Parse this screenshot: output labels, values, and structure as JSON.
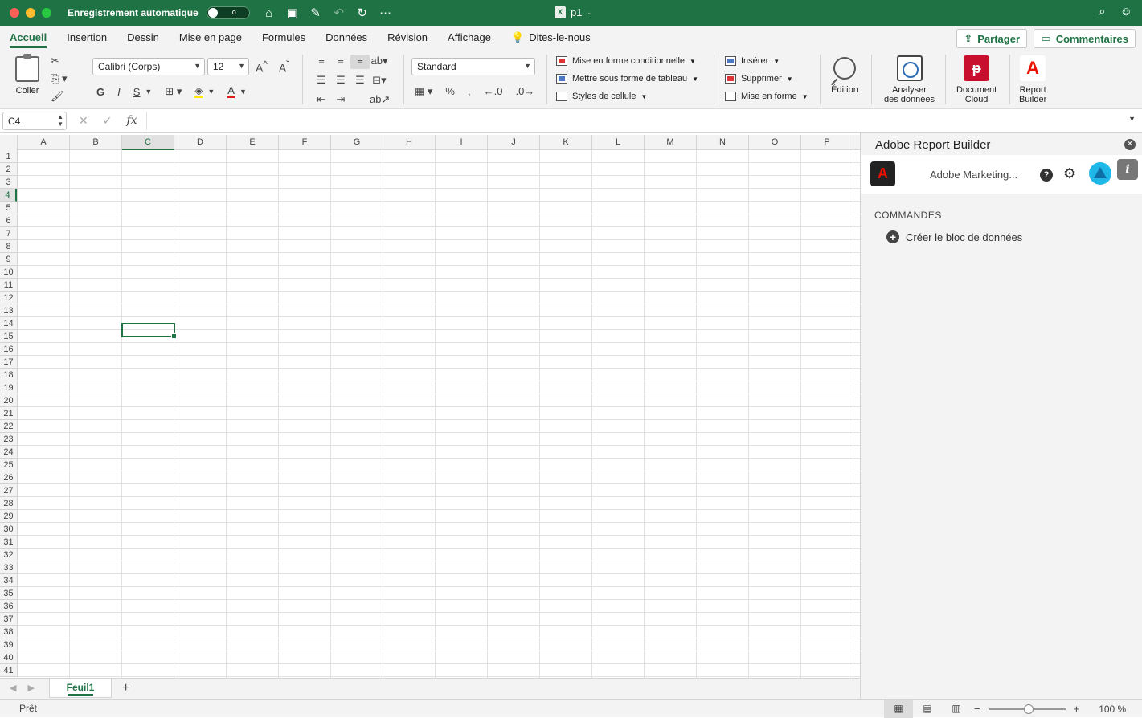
{
  "titlebar": {
    "autosave_label": "Enregistrement automatique",
    "toggle_state": "o",
    "doc_title": "p1",
    "doc_badge": "X"
  },
  "tabs": [
    "Accueil",
    "Insertion",
    "Dessin",
    "Mise en page",
    "Formules",
    "Données",
    "Révision",
    "Affichage"
  ],
  "tell_me": "Dites-le-nous",
  "share_label": "Partager",
  "comments_label": "Commentaires",
  "ribbon": {
    "paste_label": "Coller",
    "font_name": "Calibri (Corps)",
    "font_size": "12",
    "bold": "G",
    "italic": "I",
    "underline": "S",
    "number_format": "Standard",
    "cond_format": "Mise en forme conditionnelle",
    "format_table": "Mettre sous forme de tableau",
    "cell_styles": "Styles de cellule",
    "insert": "Insérer",
    "delete": "Supprimer",
    "format": "Mise en forme",
    "edition": "Édition",
    "analyze_l1": "Analyser",
    "analyze_l2": "des données",
    "doccloud_l1": "Document",
    "doccloud_l2": "Cloud",
    "rb_l1": "Report",
    "rb_l2": "Builder"
  },
  "formula_bar": {
    "name_box": "C4",
    "fx": "fx",
    "value": ""
  },
  "columns": [
    "A",
    "B",
    "C",
    "D",
    "E",
    "F",
    "G",
    "H",
    "I",
    "J",
    "K",
    "L",
    "M",
    "N",
    "O",
    "P"
  ],
  "selected_column": "C",
  "rows": [
    "1",
    "2",
    "3",
    "4",
    "5",
    "6",
    "7",
    "8",
    "9",
    "10",
    "11",
    "12",
    "13",
    "14",
    "15",
    "16",
    "17",
    "18",
    "19",
    "20",
    "21",
    "22",
    "23",
    "24",
    "25",
    "26",
    "27",
    "28",
    "29",
    "30",
    "31",
    "32",
    "33",
    "34",
    "35",
    "36",
    "37",
    "38",
    "39",
    "40",
    "41"
  ],
  "selected_row": "4",
  "sheet": {
    "tab_name": "Feuil1",
    "add": "+"
  },
  "status": {
    "text": "Prêt",
    "zoom": "100 %"
  },
  "pane": {
    "title": "Adobe Report Builder",
    "account": "Adobe Marketing...",
    "commands_title": "COMMANDES",
    "create_block": "Créer le bloc de données"
  }
}
